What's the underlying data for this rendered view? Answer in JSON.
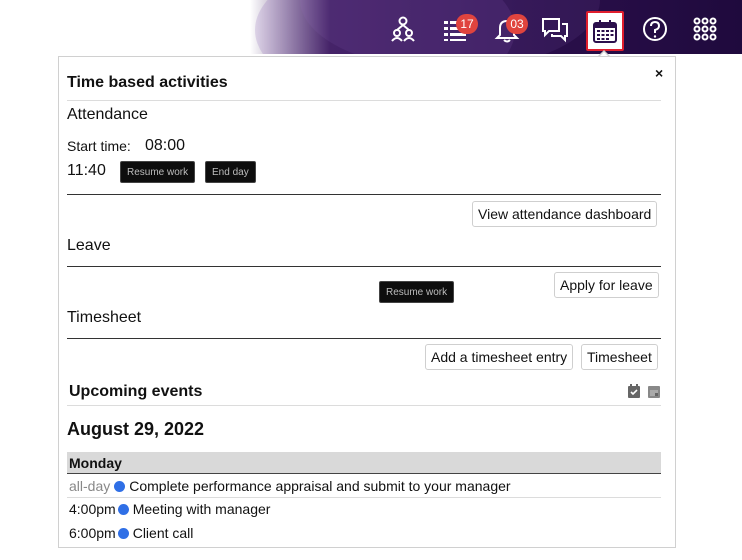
{
  "topbar": {
    "tasks_badge": "17",
    "notifications_badge": "03"
  },
  "panel": {
    "title": "Time based activities",
    "close": "×",
    "attendance": {
      "heading": "Attendance",
      "start_label": "Start time:",
      "start_value": "08:00",
      "current_time": "11:40",
      "resume_label": "Resume work",
      "end_day_label": "End day",
      "dashboard_label": "View attendance dashboard"
    },
    "leave": {
      "heading": "Leave",
      "apply_label": "Apply for leave",
      "tooltip": "Resume work"
    },
    "timesheet": {
      "heading": "Timesheet",
      "add_entry_label": "Add a timesheet entry",
      "timesheet_label": "Timesheet"
    },
    "events": {
      "heading": "Upcoming events",
      "date": "August 29, 2022",
      "day": "Monday",
      "items": [
        {
          "time": "all-day",
          "title": "Complete performance appraisal and submit to your manager"
        },
        {
          "time": "4:00pm",
          "title": "Meeting with manager"
        },
        {
          "time": "6:00pm",
          "title": "Client call"
        }
      ]
    }
  },
  "colors": {
    "badge": "#e0443e",
    "event_dot": "#2f6fe6",
    "highlight_border": "#e01e2e"
  }
}
